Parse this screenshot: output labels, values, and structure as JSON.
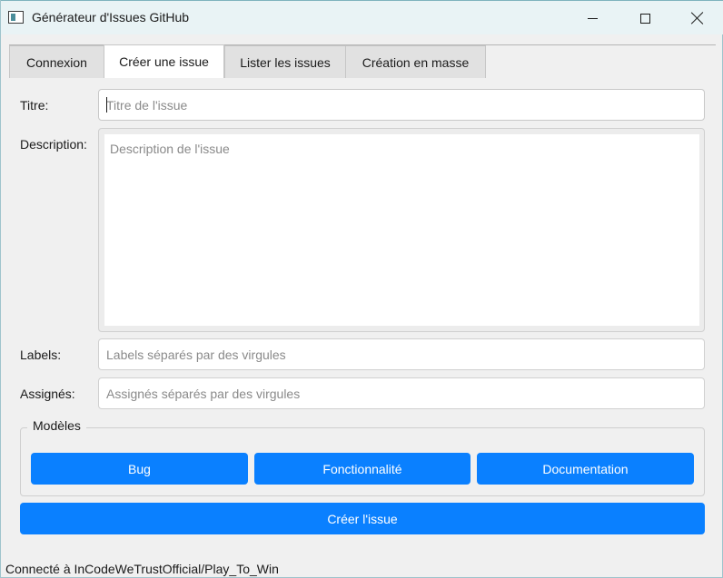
{
  "window": {
    "title": "Générateur d'Issues GitHub"
  },
  "tabs": [
    {
      "label": "Connexion",
      "active": false
    },
    {
      "label": "Créer une issue",
      "active": true
    },
    {
      "label": "Lister les issues",
      "active": false
    },
    {
      "label": "Création en masse",
      "active": false
    }
  ],
  "form": {
    "title_label": "Titre:",
    "title_placeholder": "Titre de l'issue",
    "title_value": "",
    "description_label": "Description:",
    "description_placeholder": "Description de l'issue",
    "description_value": "",
    "labels_label": "Labels:",
    "labels_placeholder": "Labels séparés par des virgules",
    "labels_value": "",
    "assignees_label": "Assignés:",
    "assignees_placeholder": "Assignés séparés par des virgules",
    "assignees_value": ""
  },
  "templates": {
    "group_title": "Modèles",
    "buttons": [
      "Bug",
      "Fonctionnalité",
      "Documentation"
    ]
  },
  "actions": {
    "create_label": "Créer l'issue"
  },
  "status": {
    "text": "Connecté à InCodeWeTrustOfficial/Play_To_Win"
  },
  "colors": {
    "accent": "#0a80ff",
    "titlebar": "#e9f3f5",
    "background": "#f0f0f0"
  },
  "icons": {
    "app": "app-window-icon",
    "minimize": "minimize-icon",
    "maximize": "maximize-icon",
    "close": "close-icon"
  }
}
